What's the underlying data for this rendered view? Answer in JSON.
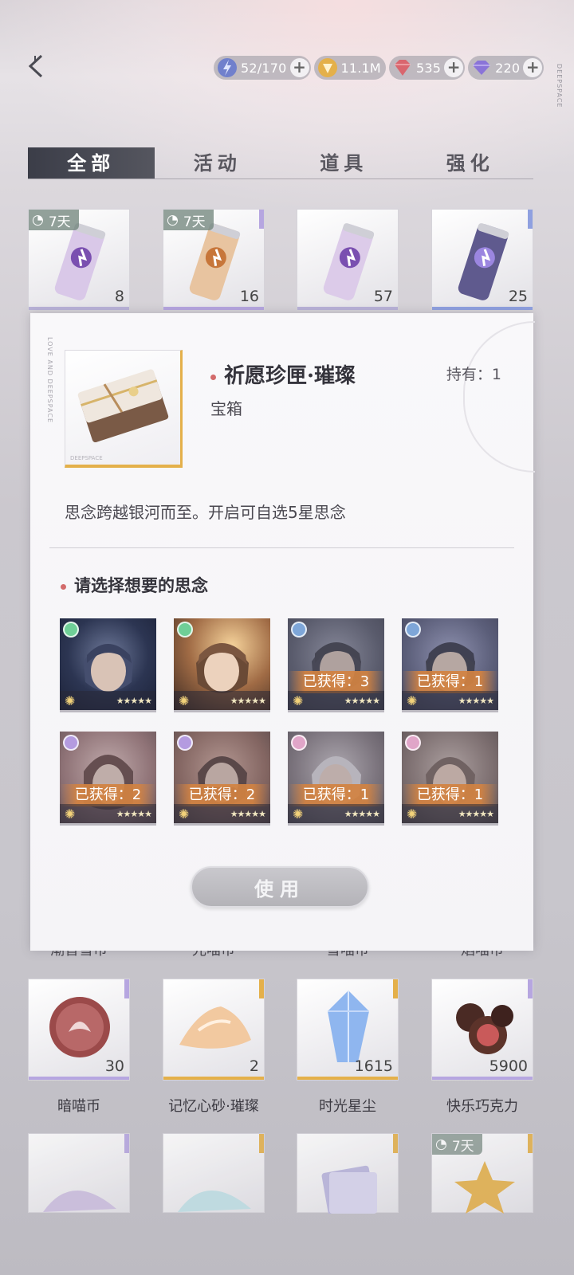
{
  "header": {
    "resources": [
      {
        "icon": "stamina-icon",
        "value": "52/170",
        "color": "#6a7ad0"
      },
      {
        "icon": "gold-coin-icon",
        "value": "11.1M",
        "color": "#e4b04a"
      },
      {
        "icon": "red-gem-icon",
        "value": "535",
        "color": "#d9666e"
      },
      {
        "icon": "purple-diamond-icon",
        "value": "220",
        "color": "#8a74d8"
      }
    ],
    "side_text": "DEEPSPACE"
  },
  "tabs": [
    {
      "label": "全部",
      "active": true
    },
    {
      "label": "活动",
      "active": false
    },
    {
      "label": "道具",
      "active": false
    },
    {
      "label": "强化",
      "active": false
    }
  ],
  "top_row": [
    {
      "name": "drink-can-purple",
      "badge": "7天",
      "count": "8",
      "quality_color": "#9b8fd0"
    },
    {
      "name": "drink-can-gold",
      "badge": "7天",
      "count": "16",
      "quality_color": "#a88bd8"
    },
    {
      "name": "drink-can-purple-2",
      "badge": "",
      "count": "57",
      "quality_color": "#9b8fd0"
    },
    {
      "name": "drink-can-dark",
      "badge": "",
      "count": "25",
      "quality_color": "#7d8ed8"
    }
  ],
  "modal": {
    "item_name": "祈愿珍匣·璀璨",
    "item_type": "宝箱",
    "owned": "持有：1",
    "description": "思念跨越银河而至。开启可自选5星思念",
    "select_title": "请选择想要的思念",
    "thumb_tag": "DEEPSPACE",
    "side_text": "LOVE AND DEEPSPACE",
    "use_button": "使用",
    "characters": [
      {
        "name": "character-card-1",
        "obtained": "",
        "rarity": "green",
        "stars": "★★★★★"
      },
      {
        "name": "character-card-2",
        "obtained": "",
        "rarity": "green",
        "stars": "★★★★★"
      },
      {
        "name": "character-card-3",
        "obtained": "已获得：3",
        "rarity": "blue",
        "stars": "★★★★★"
      },
      {
        "name": "character-card-4",
        "obtained": "已获得：1",
        "rarity": "blue",
        "stars": "★★★★★"
      },
      {
        "name": "character-card-5",
        "obtained": "已获得：2",
        "rarity": "purple",
        "stars": "★★★★★"
      },
      {
        "name": "character-card-6",
        "obtained": "已获得：2",
        "rarity": "purple",
        "stars": "★★★★★"
      },
      {
        "name": "character-card-7",
        "obtained": "已获得：1",
        "rarity": "pink",
        "stars": "★★★★★"
      },
      {
        "name": "character-card-8",
        "obtained": "已获得：1",
        "rarity": "pink",
        "stars": "★★★★★"
      }
    ]
  },
  "partial_labels": [
    "潮音雪币",
    "光喵币",
    "雪喵币",
    "焰喵币"
  ],
  "bottom_row": [
    {
      "label": "暗喵币",
      "count": "30",
      "quality_color": "#9b8fd0"
    },
    {
      "label": "记忆心砂·璀璨",
      "count": "2",
      "quality_color": "#e4b04a"
    },
    {
      "label": "时光星尘",
      "count": "1615",
      "quality_color": "#e4b04a"
    },
    {
      "label": "快乐巧克力",
      "count": "5900",
      "quality_color": "#a88bd8"
    }
  ],
  "last_row_badge": "7天"
}
